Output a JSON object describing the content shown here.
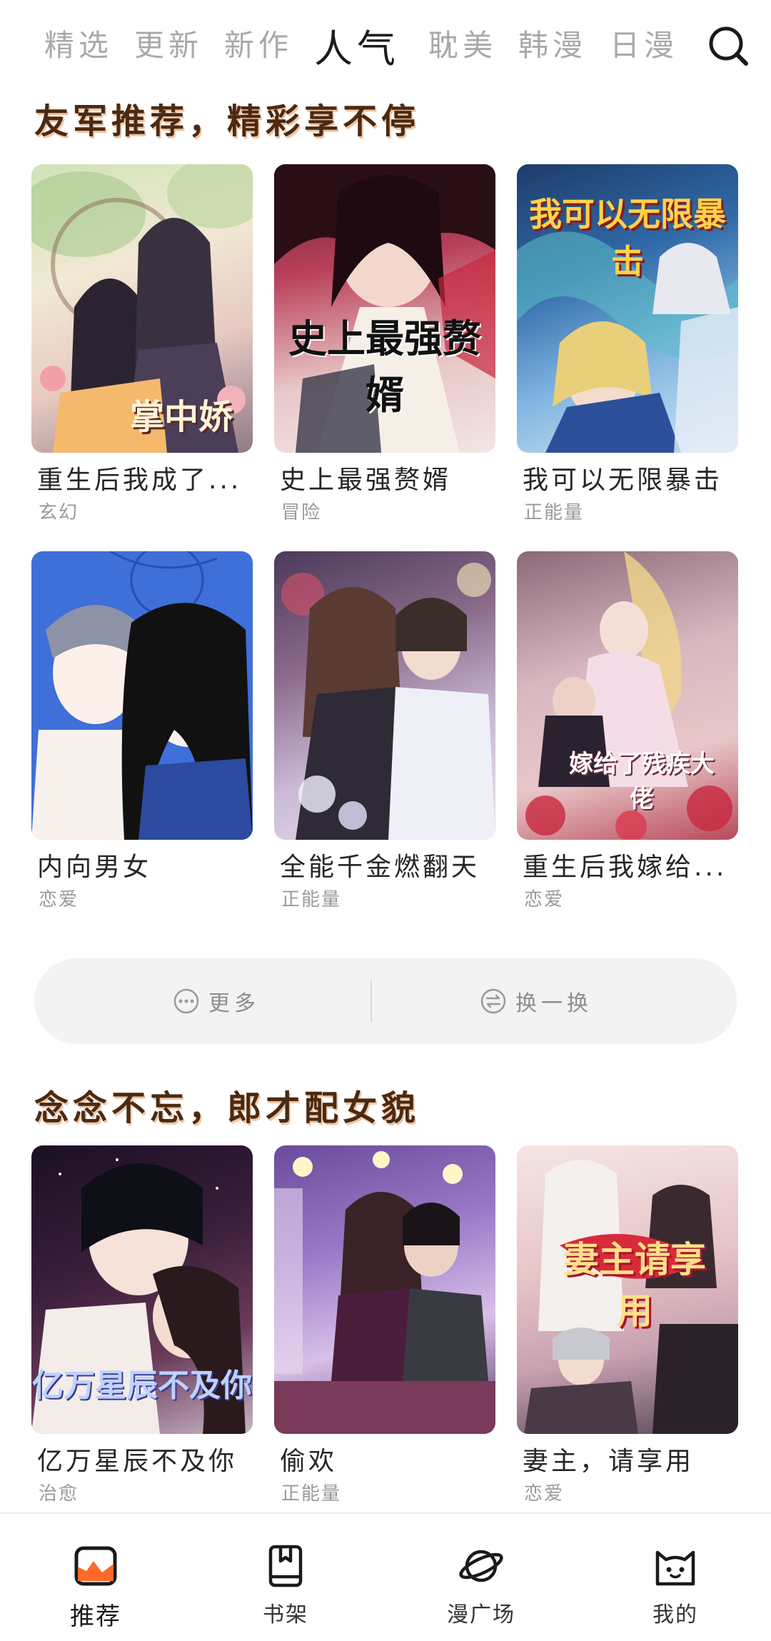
{
  "top_tabs": [
    "精选",
    "更新",
    "新作",
    "人气",
    "耽美",
    "韩漫",
    "日漫"
  ],
  "active_tab": "人气",
  "section1": {
    "title": "友军推荐，精彩享不停",
    "items": [
      {
        "title": "重生后我成了...",
        "genre": "玄幻",
        "cover_text": "掌中娇"
      },
      {
        "title": "史上最强赘婿",
        "genre": "冒险",
        "cover_text": "史上最强赘婿"
      },
      {
        "title": "我可以无限暴击",
        "genre": "正能量",
        "cover_text": "我可以无限暴击"
      },
      {
        "title": "内向男女",
        "genre": "恋爱",
        "cover_text": ""
      },
      {
        "title": "全能千金燃翻天",
        "genre": "正能量",
        "cover_text": ""
      },
      {
        "title": "重生后我嫁给...",
        "genre": "恋爱",
        "cover_text": "嫁给了残疾大佬"
      }
    ]
  },
  "actions": {
    "more": "更多",
    "refresh": "换一换"
  },
  "section2": {
    "title": "念念不忘，郎才配女貌",
    "items": [
      {
        "title": "亿万星辰不及你",
        "genre": "治愈",
        "cover_text": "亿万星辰不及你"
      },
      {
        "title": "偷欢",
        "genre": "正能量",
        "cover_text": ""
      },
      {
        "title": "妻主，请享用",
        "genre": "恋爱",
        "cover_text": "妻主请享用"
      }
    ]
  },
  "bottom_nav": [
    {
      "label": "推荐",
      "icon": "recommend-icon",
      "active": true
    },
    {
      "label": "书架",
      "icon": "bookshelf-icon",
      "active": false
    },
    {
      "label": "漫广场",
      "icon": "planet-icon",
      "active": false
    },
    {
      "label": "我的",
      "icon": "cat-profile-icon",
      "active": false
    }
  ],
  "colors": {
    "title_text": "#4a2a12",
    "title_glow": "#e8965a",
    "accent": "#ff6a2a",
    "inactive_tab": "#a9a9a9"
  }
}
